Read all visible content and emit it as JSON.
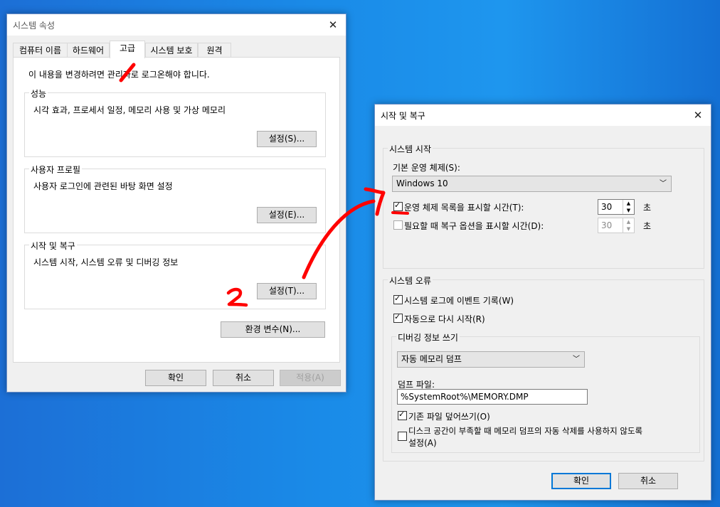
{
  "sys": {
    "title": "시스템 속성",
    "tabs": [
      "컴퓨터 이름",
      "하드웨어",
      "고급",
      "시스템 보호",
      "원격"
    ],
    "admin_note": "이 내용을 변경하려면 관리자로 로그온해야 합니다.",
    "perf": {
      "label": "성능",
      "desc": "시각 효과, 프로세서 일정, 메모리 사용 및 가상 메모리",
      "button": "설정(S)..."
    },
    "profile": {
      "label": "사용자 프로필",
      "desc": "사용자 로그인에 관련된 바탕 화면 설정",
      "button": "설정(E)..."
    },
    "startup": {
      "label": "시작 및 복구",
      "desc": "시스템 시작, 시스템 오류 및 디버깅 정보",
      "button": "설정(T)..."
    },
    "env_button": "환경 변수(N)...",
    "ok": "확인",
    "cancel": "취소",
    "apply": "적용(A)"
  },
  "rec": {
    "title": "시작 및 복구",
    "startup_group": "시스템 시작",
    "default_os_label": "기본 운영 체제(S):",
    "default_os_value": "Windows 10",
    "show_os_list": {
      "label": "운영 체제 목록을 표시할 시간(T):",
      "checked": true,
      "value": "30",
      "unit": "초"
    },
    "show_recovery": {
      "label": "필요할 때 복구 옵션을 표시할 시간(D):",
      "checked": false,
      "value": "30",
      "unit": "초"
    },
    "failure_group": "시스템 오류",
    "write_event": {
      "label": "시스템 로그에 이벤트 기록(W)",
      "checked": true
    },
    "auto_restart": {
      "label": "자동으로 다시 시작(R)",
      "checked": true
    },
    "debug_group": "디버깅 정보 쓰기",
    "dump_type": "자동 메모리 덤프",
    "dump_file_label": "덤프 파일:",
    "dump_file_value": "%SystemRoot%\\MEMORY.DMP",
    "overwrite": {
      "label": "기존 파일 덮어쓰기(O)",
      "checked": true
    },
    "disable_auto_delete": {
      "label_line1": "디스크 공간이 부족할 때 메모리 덤프의 자동 삭제를 사용하지 않도록",
      "label_line2": "설정(A)",
      "checked": false
    },
    "ok": "확인",
    "cancel": "취소"
  },
  "annotations": {
    "mark1": "1",
    "mark2": "2",
    "color": "#ff0000"
  }
}
